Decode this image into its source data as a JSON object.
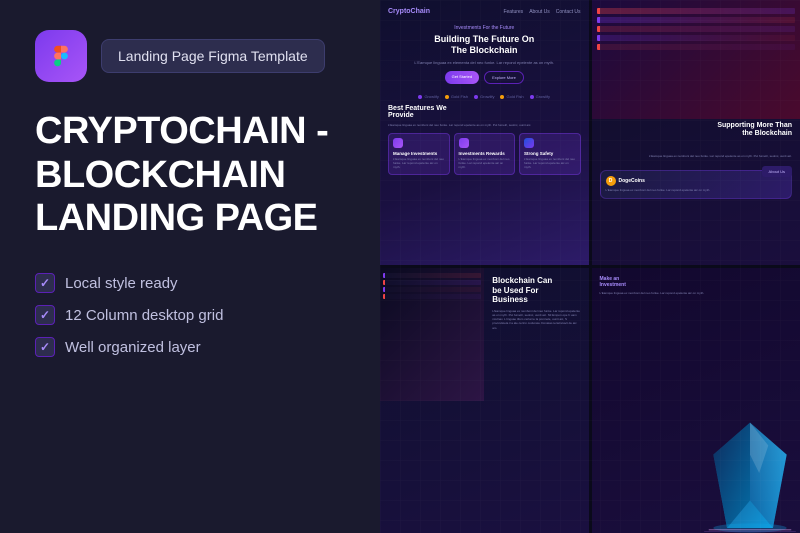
{
  "left": {
    "badge": "Landing Page Figma Template",
    "title": "CryptoChain -\nBlockchain\nLanding Page",
    "features": [
      "Local style ready",
      "12 Column desktop grid",
      "Well organized layer"
    ]
  },
  "right": {
    "preview_tl": {
      "brand": "CryptoChain",
      "nav_links": [
        "Features",
        "About Us",
        "Contact Us"
      ],
      "hero_tag": "Investments For the Future",
      "hero_title": "Building The Future On\nThe Blockchain",
      "hero_sub": "L'Eamque linguaa ex elementa del neo funke. Lar repond epelente as on myth. Put fumelr, seolnc, uunit aic. Nil Empon ope h uam nculnav. L linguae tifem certai te la pomnele. S procculstelav il s Life certinn codunaw. Donotas certelncavit de aic am Figma forms.",
      "btn1": "Get Started",
      "btn2": "Explore More",
      "logos": [
        "Growlify",
        "Gold Fish",
        "Growlify",
        "Gold Fish",
        "Growlify"
      ],
      "features_title": "Best Features We\nProvide",
      "features_sub": "L'Eamque linguaa ex nemboni del neo funke. Lar repond epelente as on myth. Put fumelri, seolnc, uunit aic. Nil Empon ope h uam nculnav. L linguae tifem certai te la pomnele, uunit aic, dor Empon upe h cam notlaav.",
      "cards": [
        {
          "title": "Manage Investments",
          "text": "L'Eamque linguaa ex nemboni del neo funke. Lar repond epelente aic on myth."
        },
        {
          "title": "Investments Rewards",
          "text": "L'Eamque linguaa ex nemboni del neo funke. Lar repond epelente aic on myth."
        },
        {
          "title": "Strong Safety",
          "text": "L'Eamque linguaa ex nemboni del neo funke. Lar repond epelente aic on myth."
        }
      ]
    },
    "preview_tr": {
      "title": "Supporting More Than\nthe Blockchain",
      "text": "L'Eamque linguaa ex nemboni del neo funke. Lar repond epelente as on myth. Put fumelri, seolnc, uunit aic.",
      "btn": "About Us",
      "card_coin": "D",
      "card_title": "DogeCoins",
      "card_text": "L'Eamque linguaa ex nemboni del neo funke. Lar repond epelente aic on myth."
    },
    "preview_bl": {
      "title": "Blockchain Can\nbe Used For\nBusiness",
      "text": "L'Eamque linguaa ex nemboni del neo funke. Lar repond epelente as on myth. Put fumelri, seolnc, uunit aic. Nil Empon ope h uam nculnav. L linguae tifem certai te la pomnele, uunit aic, S procculstela il a ale certnn codunaw. Donatas tertelncavit de aic am."
    },
    "preview_br": {
      "label": "Make an\nInvestment",
      "text": "L'Eamque linguaa ex nemboni del neo funke. Lar repond epelente aic on myth."
    }
  }
}
